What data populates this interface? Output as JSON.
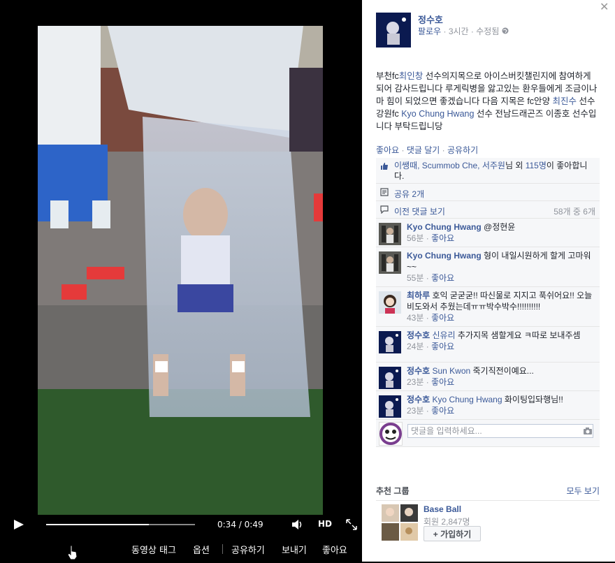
{
  "video": {
    "time_current": "0:34",
    "time_total": "0:49",
    "progress": 0.69,
    "hd_label": "HD",
    "actions": [
      "동영상 태그",
      "옵션",
      "공유하기",
      "보내기",
      "좋아요"
    ]
  },
  "post": {
    "author": "정수호",
    "follow": "팔로우",
    "time": "3시간",
    "edited": "수정됨",
    "text_parts": [
      {
        "t": "부천fc",
        "link": false
      },
      {
        "t": "최인창",
        "link": true
      },
      {
        "t": " 선수의지목으로 아이스버킷챌린지에 참여하게 되어 감사드립니다 루게릭병을 앓고있는 환우들에게 조금이나마 힘이 되었으면 좋겠습니다 다음 지목은 fc안양 ",
        "link": false
      },
      {
        "t": "최진수",
        "link": true
      },
      {
        "t": " 선수 강원fc ",
        "link": false
      },
      {
        "t": "Kyo Chung Hwang",
        "link": true
      },
      {
        "t": " 선수 전남드래곤즈 이종호 선수입니다 부탁드립니당",
        "link": false
      }
    ],
    "actions": {
      "like": "좋아요",
      "comment": "댓글 달기",
      "share": "공유하기"
    }
  },
  "ufi": {
    "likes_link": "이쌩때, Scummob Che, 서주원",
    "likes_mid": "님 외 ",
    "likes_count": "115명",
    "likes_tail": "이 좋아합니다.",
    "shares": "공유 2개",
    "prev_comments": "이전 댓글 보기",
    "comment_count": "58개 중 6개",
    "reply_placeholder": "댓글을 입력하세요..."
  },
  "comments": [
    {
      "author": "Kyo Chung Hwang",
      "mention": "",
      "text": " @정현윤",
      "time": "56분",
      "like": "좋아요",
      "height": 40,
      "avatar": "player"
    },
    {
      "author": "Kyo Chung Hwang",
      "mention": "",
      "text": " 형이 내일시원하게 할게 고마워~~",
      "time": "55분",
      "like": "좋아요",
      "height": 56,
      "avatar": "player"
    },
    {
      "author": "최하루",
      "mention": "",
      "text": " 호익 굳굳굳!! 따신물로 지지고 푹쉬어요!! 오늘 비도와서 추웠는데ㅠㅠ박수박수!!!!!!!!!!",
      "time": "43분",
      "like": "좋아요",
      "height": 56,
      "avatar": "girl"
    },
    {
      "author": "정수호",
      "mention": " 신유리",
      "text": " 추가지목 샘할게요 ㅋ따로 보내주셈",
      "time": "24분",
      "like": "좋아요",
      "height": 50,
      "avatar": "self"
    },
    {
      "author": "정수호",
      "mention": " Sun Kwon",
      "text": " 죽기직전이예요...",
      "time": "23분",
      "like": "좋아요",
      "height": 40,
      "avatar": "self"
    },
    {
      "author": "정수호",
      "mention": " Kyo Chung Hwang",
      "text": " 화이팅입돠행님!!",
      "time": "23분",
      "like": "좋아요",
      "height": 40,
      "avatar": "self"
    }
  ],
  "recommend": {
    "title": "추천 그룹",
    "see_all": "모두 보기",
    "group_name": "Base Ball",
    "members": "회원 2,847명",
    "join": "+ 가입하기"
  }
}
